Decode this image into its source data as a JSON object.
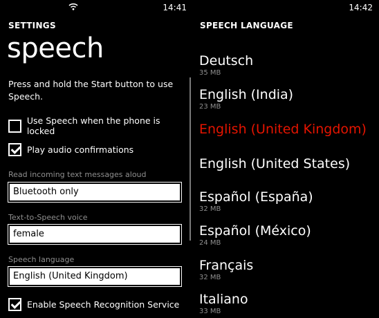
{
  "left": {
    "status_time": "14:41",
    "header": "SETTINGS",
    "title": "speech",
    "description": "Press and hold the Start button to use Speech.",
    "checkbox_locked": {
      "label": "Use Speech when the phone is locked",
      "checked": false
    },
    "checkbox_audio": {
      "label": "Play audio confirmations",
      "checked": true
    },
    "read_messages": {
      "label": "Read incoming text messages aloud",
      "value": "Bluetooth only"
    },
    "tts_voice": {
      "label": "Text-to-Speech voice",
      "value": "female"
    },
    "speech_language": {
      "label": "Speech language",
      "value": "English (United Kingdom)"
    },
    "checkbox_recognition": {
      "label": "Enable Speech Recognition Service",
      "checked": true
    }
  },
  "right": {
    "status_time": "14:42",
    "header": "SPEECH LANGUAGE",
    "languages": [
      {
        "name": "Deutsch",
        "size": "35 MB"
      },
      {
        "name": "English (India)",
        "size": "23 MB"
      },
      {
        "name": "English (United Kingdom)",
        "size": "",
        "selected": true
      },
      {
        "name": "English (United States)",
        "size": ""
      },
      {
        "name": "Español (España)",
        "size": "32 MB"
      },
      {
        "name": "Español (México)",
        "size": "24 MB"
      },
      {
        "name": "Français",
        "size": "32 MB"
      },
      {
        "name": "Italiano",
        "size": "33 MB"
      }
    ]
  },
  "colors": {
    "accent": "#e51400",
    "background": "#000000",
    "subtle": "#8f8f8f"
  },
  "icons": {
    "status": "wifi-icon",
    "check": "checkmark-icon"
  }
}
